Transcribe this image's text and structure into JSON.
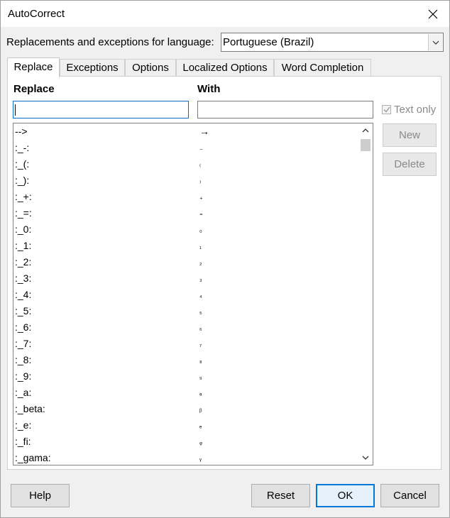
{
  "window": {
    "title": "AutoCorrect",
    "close_icon": "close-icon"
  },
  "language": {
    "label": "Replacements and exceptions for language:",
    "selected": "Portuguese (Brazil)"
  },
  "tabs": [
    {
      "label": "Replace",
      "active": true
    },
    {
      "label": "Exceptions"
    },
    {
      "label": "Options"
    },
    {
      "label": "Localized Options"
    },
    {
      "label": "Word Completion"
    }
  ],
  "replace_tab": {
    "replace_header": "Replace",
    "with_header": "With",
    "replace_value": "",
    "with_value": "",
    "text_only_label": "Text only",
    "text_only_checked": true,
    "new_label": "New",
    "delete_label": "Delete",
    "entries": [
      {
        "replace": "-->",
        "with": "→"
      },
      {
        "replace": ":_-:",
        "with": "₋"
      },
      {
        "replace": ":_(:",
        "with": "₍"
      },
      {
        "replace": ":_):",
        "with": "₎"
      },
      {
        "replace": ":_+:",
        "with": "₊"
      },
      {
        "replace": ":_=:",
        "with": "₌"
      },
      {
        "replace": ":_0:",
        "with": "₀"
      },
      {
        "replace": ":_1:",
        "with": "₁"
      },
      {
        "replace": ":_2:",
        "with": "₂"
      },
      {
        "replace": ":_3:",
        "with": "₃"
      },
      {
        "replace": ":_4:",
        "with": "₄"
      },
      {
        "replace": ":_5:",
        "with": "₅"
      },
      {
        "replace": ":_6:",
        "with": "₆"
      },
      {
        "replace": ":_7:",
        "with": "₇"
      },
      {
        "replace": ":_8:",
        "with": "₈"
      },
      {
        "replace": ":_9:",
        "with": "₉"
      },
      {
        "replace": ":_a:",
        "with": "ₐ"
      },
      {
        "replace": ":_beta:",
        "with": "ᵦ"
      },
      {
        "replace": ":_e:",
        "with": "ₑ"
      },
      {
        "replace": ":_fi:",
        "with": "ᵩ"
      },
      {
        "replace": ":_gama:",
        "with": "ᵧ"
      }
    ]
  },
  "buttons": {
    "help": "Help",
    "reset": "Reset",
    "ok": "OK",
    "cancel": "Cancel"
  }
}
